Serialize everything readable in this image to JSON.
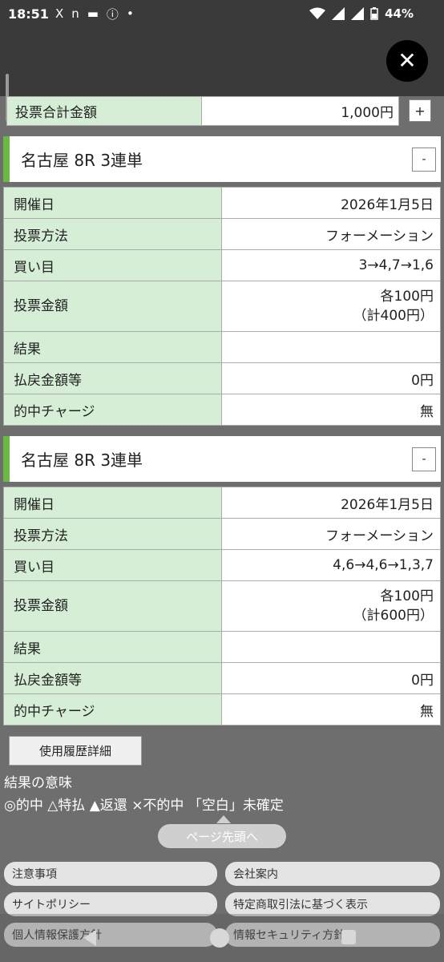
{
  "status_bar": {
    "time": "18:51",
    "icons_left": [
      "X",
      "n",
      "▬",
      "ⓘ",
      "•"
    ],
    "battery": "44%"
  },
  "close_label": "✕",
  "total": {
    "label": "投票合計金額",
    "value": "1,000円",
    "plus_label": "+"
  },
  "tickets": [
    {
      "title": "名古屋 8R 3連単",
      "collapse_label": "-",
      "rows": [
        {
          "label": "開催日",
          "value": "2026年1月5日"
        },
        {
          "label": "投票方法",
          "value": "フォーメーション"
        },
        {
          "label": "買い目",
          "value": "3→4,7→1,6"
        },
        {
          "label": "投票金額",
          "value": "各100円",
          "value2": "（計400円）"
        },
        {
          "label": "結果",
          "value": ""
        },
        {
          "label": "払戻金額等",
          "value": "0円"
        },
        {
          "label": "的中チャージ",
          "value": "無"
        }
      ]
    },
    {
      "title": "名古屋 8R 3連単",
      "collapse_label": "-",
      "rows": [
        {
          "label": "開催日",
          "value": "2026年1月5日"
        },
        {
          "label": "投票方法",
          "value": "フォーメーション"
        },
        {
          "label": "買い目",
          "value": "4,6→4,6→1,3,7"
        },
        {
          "label": "投票金額",
          "value": "各100円",
          "value2": "（計600円）"
        },
        {
          "label": "結果",
          "value": ""
        },
        {
          "label": "払戻金額等",
          "value": "0円"
        },
        {
          "label": "的中チャージ",
          "value": "無"
        }
      ]
    }
  ],
  "detail_button": "使用履歴詳細",
  "legend": {
    "title": "結果の意味",
    "text": "◎的中 △特払 ▲返還 ×不的中 「空白」未確定"
  },
  "page_top": "ページ先頭へ",
  "footer_links": [
    "注意事項",
    "会社案内",
    "サイトポリシー",
    "特定商取引法に基づく表示",
    "個人情報保護方針",
    "情報セキュリティ方針"
  ]
}
